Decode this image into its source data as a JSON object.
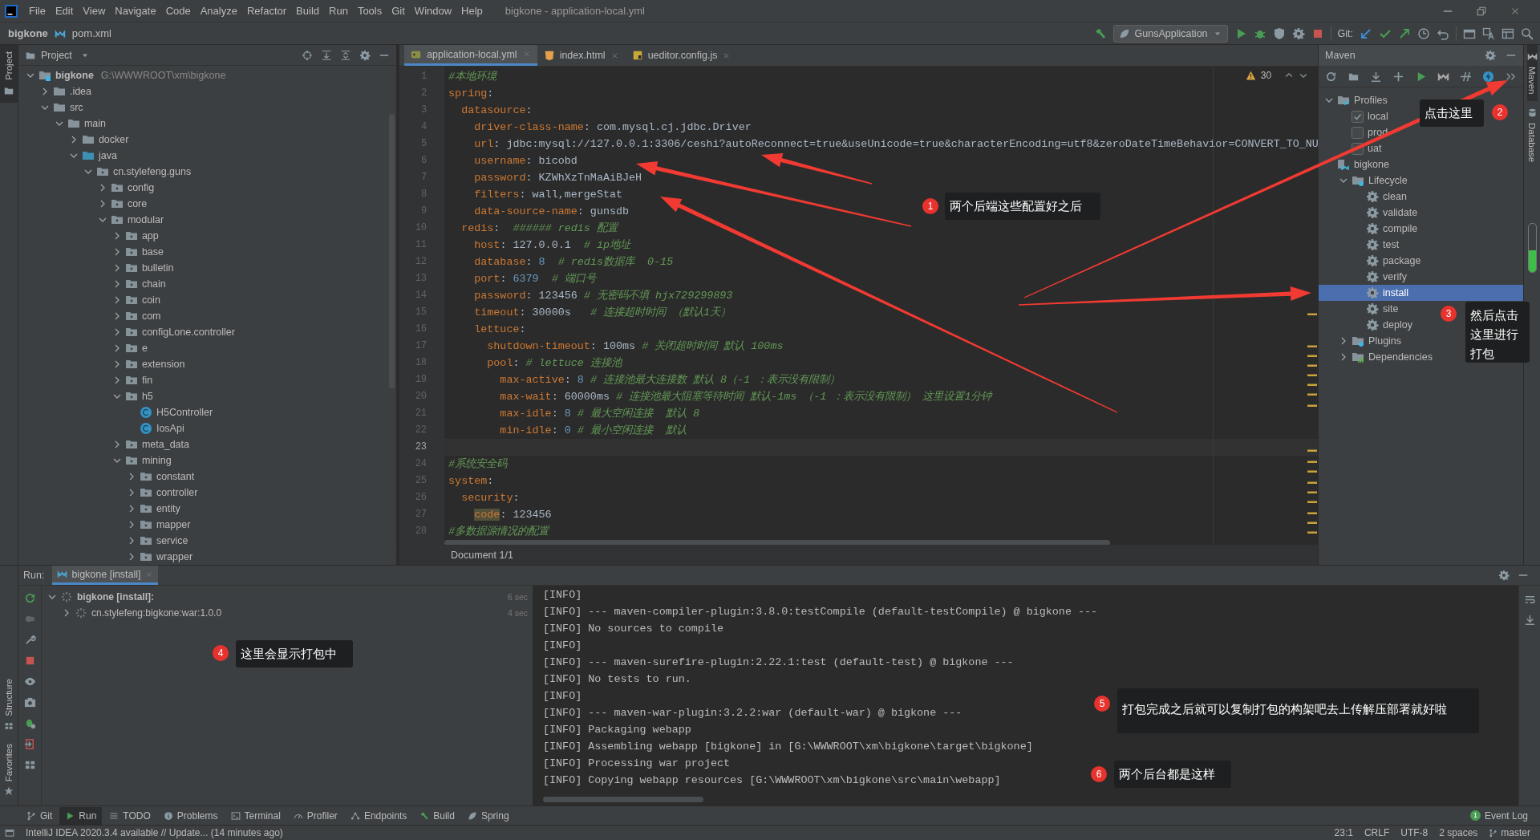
{
  "window": {
    "title": "bigkone - application-local.yml"
  },
  "menu": [
    "File",
    "Edit",
    "View",
    "Navigate",
    "Code",
    "Analyze",
    "Refactor",
    "Build",
    "Run",
    "Tools",
    "Git",
    "Window",
    "Help"
  ],
  "breadcrumb": [
    "bigkone",
    "pom.xml"
  ],
  "toolbar": {
    "run_config": "GunsApplication",
    "vcs_label": "Git:"
  },
  "left_strip": {
    "top": [
      "Project"
    ],
    "bottom": [
      "Structure",
      "Favorites"
    ]
  },
  "right_strip": [
    {
      "label": "Maven",
      "selected": true
    },
    {
      "label": "Database",
      "selected": false
    }
  ],
  "project": {
    "title": "Project",
    "tree": [
      {
        "name": "bigkone",
        "kind": "module",
        "path": "G:\\WWWROOT\\xm\\bigkone",
        "expanded": true,
        "children": [
          {
            "name": ".idea",
            "kind": "folder",
            "expanded": false
          },
          {
            "name": "src",
            "kind": "folder",
            "expanded": true,
            "children": [
              {
                "name": "main",
                "kind": "folder",
                "expanded": true,
                "children": [
                  {
                    "name": "docker",
                    "kind": "folder",
                    "expanded": false
                  },
                  {
                    "name": "java",
                    "kind": "source",
                    "expanded": true,
                    "children": [
                      {
                        "name": "cn.stylefeng.guns",
                        "kind": "package",
                        "expanded": true,
                        "children": [
                          {
                            "name": "config",
                            "kind": "package",
                            "expanded": false
                          },
                          {
                            "name": "core",
                            "kind": "package",
                            "expanded": false
                          },
                          {
                            "name": "modular",
                            "kind": "package",
                            "expanded": true,
                            "children": [
                              {
                                "name": "app",
                                "kind": "package",
                                "expanded": false
                              },
                              {
                                "name": "base",
                                "kind": "package",
                                "expanded": false
                              },
                              {
                                "name": "bulletin",
                                "kind": "package",
                                "expanded": false
                              },
                              {
                                "name": "chain",
                                "kind": "package",
                                "expanded": false
                              },
                              {
                                "name": "coin",
                                "kind": "package",
                                "expanded": false
                              },
                              {
                                "name": "com",
                                "kind": "package",
                                "expanded": false
                              },
                              {
                                "name": "configLone.controller",
                                "kind": "package",
                                "expanded": false
                              },
                              {
                                "name": "e",
                                "kind": "package",
                                "expanded": false
                              },
                              {
                                "name": "extension",
                                "kind": "package",
                                "expanded": false
                              },
                              {
                                "name": "fin",
                                "kind": "package",
                                "expanded": false
                              },
                              {
                                "name": "h5",
                                "kind": "package",
                                "expanded": true,
                                "children": [
                                  {
                                    "name": "H5Controller",
                                    "kind": "class"
                                  },
                                  {
                                    "name": "IosApi",
                                    "kind": "class"
                                  }
                                ]
                              },
                              {
                                "name": "meta_data",
                                "kind": "package",
                                "expanded": false
                              },
                              {
                                "name": "mining",
                                "kind": "package",
                                "expanded": true,
                                "children": [
                                  {
                                    "name": "constant",
                                    "kind": "package",
                                    "expanded": false
                                  },
                                  {
                                    "name": "controller",
                                    "kind": "package",
                                    "expanded": false
                                  },
                                  {
                                    "name": "entity",
                                    "kind": "package",
                                    "expanded": false
                                  },
                                  {
                                    "name": "mapper",
                                    "kind": "package",
                                    "expanded": false
                                  },
                                  {
                                    "name": "service",
                                    "kind": "package",
                                    "expanded": false
                                  },
                                  {
                                    "name": "wrapper",
                                    "kind": "package",
                                    "expanded": false
                                  }
                                ]
                              }
                            ]
                          }
                        ]
                      }
                    ]
                  }
                ]
              }
            ]
          }
        ]
      }
    ]
  },
  "editor": {
    "tabs": [
      {
        "label": "application-local.yml",
        "kind": "yaml",
        "selected": true
      },
      {
        "label": "index.html",
        "kind": "html",
        "selected": false
      },
      {
        "label": "ueditor.config.js",
        "kind": "js",
        "selected": false
      }
    ],
    "warnings": "30",
    "lines": [
      {
        "number": "1",
        "current": false,
        "tokens": [
          {
            "kind": "comment",
            "text": "#本地环境"
          }
        ]
      },
      {
        "number": "2",
        "current": false,
        "tokens": [
          {
            "kind": "key",
            "text": "spring"
          },
          {
            "kind": "text",
            "text": ":"
          }
        ],
        "children": [
          {
            "number": "3",
            "current": false,
            "tokens": [
              {
                "kind": "key",
                "text": "datasource"
              },
              {
                "kind": "text",
                "text": ":"
              }
            ],
            "children": [
              {
                "number": "4",
                "current": false,
                "tokens": [
                  {
                    "kind": "key",
                    "text": "driver-class-name"
                  },
                  {
                    "kind": "text",
                    "text": ": com.mysql.cj.jdbc.Driver"
                  }
                ]
              },
              {
                "number": "5",
                "current": false,
                "tokens": [
                  {
                    "kind": "key",
                    "text": "url"
                  },
                  {
                    "kind": "text",
                    "text": ": jdbc:mysql://127.0.0.1:3306/ceshi?autoReconnect=true&useUnicode=true&characterEncoding=utf8&zeroDateTimeBehavior=CONVERT_TO_NU"
                  }
                ]
              },
              {
                "number": "6",
                "current": false,
                "tokens": [
                  {
                    "kind": "key",
                    "text": "username"
                  },
                  {
                    "kind": "text",
                    "text": ": bicobd"
                  }
                ]
              },
              {
                "number": "7",
                "current": false,
                "tokens": [
                  {
                    "kind": "key",
                    "text": "password"
                  },
                  {
                    "kind": "text",
                    "text": ": KZWhXzTnMaAiBJeH"
                  }
                ]
              },
              {
                "number": "8",
                "current": false,
                "tokens": [
                  {
                    "kind": "key",
                    "text": "filters"
                  },
                  {
                    "kind": "text",
                    "text": ": wall,mergeStat"
                  }
                ]
              },
              {
                "number": "9",
                "current": false,
                "tokens": [
                  {
                    "kind": "key",
                    "text": "data-source-name"
                  },
                  {
                    "kind": "text",
                    "text": ": gunsdb"
                  }
                ]
              }
            ]
          },
          {
            "number": "10",
            "current": false,
            "tokens": [
              {
                "kind": "key",
                "text": "redis"
              },
              {
                "kind": "text",
                "text": ":  "
              },
              {
                "kind": "comment",
                "text": "###### redis 配置"
              }
            ],
            "children": [
              {
                "number": "11",
                "current": false,
                "tokens": [
                  {
                    "kind": "key",
                    "text": "host"
                  },
                  {
                    "kind": "text",
                    "text": ": 127.0.0.1  "
                  },
                  {
                    "kind": "comment",
                    "text": "# ip地址"
                  }
                ]
              },
              {
                "number": "12",
                "current": false,
                "tokens": [
                  {
                    "kind": "key",
                    "text": "database"
                  },
                  {
                    "kind": "text",
                    "text": ": "
                  },
                  {
                    "kind": "number",
                    "text": "8"
                  },
                  {
                    "kind": "comment",
                    "text": "  # redis数据库  0-15"
                  }
                ]
              },
              {
                "number": "13",
                "current": false,
                "tokens": [
                  {
                    "kind": "key",
                    "text": "port"
                  },
                  {
                    "kind": "text",
                    "text": ": "
                  },
                  {
                    "kind": "number",
                    "text": "6379"
                  },
                  {
                    "kind": "comment",
                    "text": "  # 端口号"
                  }
                ]
              },
              {
                "number": "14",
                "current": false,
                "tokens": [
                  {
                    "kind": "key",
                    "text": "password"
                  },
                  {
                    "kind": "text",
                    "text": ": 123456 "
                  },
                  {
                    "kind": "comment",
                    "text": "# 无密码不填 hjx729299893"
                  }
                ]
              },
              {
                "number": "15",
                "current": false,
                "tokens": [
                  {
                    "kind": "key",
                    "text": "timeout"
                  },
                  {
                    "kind": "text",
                    "text": ": 30000s   "
                  },
                  {
                    "kind": "comment",
                    "text": "# 连接超时时间 （默认1天）"
                  }
                ]
              },
              {
                "number": "16",
                "current": false,
                "tokens": [
                  {
                    "kind": "key",
                    "text": "lettuce"
                  },
                  {
                    "kind": "text",
                    "text": ":"
                  }
                ],
                "children": [
                  {
                    "number": "17",
                    "current": false,
                    "tokens": [
                      {
                        "kind": "key",
                        "text": "shutdown-timeout"
                      },
                      {
                        "kind": "text",
                        "text": ": 100ms "
                      },
                      {
                        "kind": "comment",
                        "text": "# 关闭超时时间 默认 100ms"
                      }
                    ]
                  },
                  {
                    "number": "18",
                    "current": false,
                    "tokens": [
                      {
                        "kind": "key",
                        "text": "pool"
                      },
                      {
                        "kind": "text",
                        "text": ": "
                      },
                      {
                        "kind": "comment",
                        "text": "# lettuce 连接池"
                      }
                    ],
                    "children": [
                      {
                        "number": "19",
                        "current": false,
                        "tokens": [
                          {
                            "kind": "key",
                            "text": "max-active"
                          },
                          {
                            "kind": "text",
                            "text": ": "
                          },
                          {
                            "kind": "number",
                            "text": "8"
                          },
                          {
                            "kind": "comment",
                            "text": " # 连接池最大连接数 默认 8（-1 ：表示没有限制）"
                          }
                        ]
                      },
                      {
                        "number": "20",
                        "current": false,
                        "tokens": [
                          {
                            "kind": "key",
                            "text": "max-wait"
                          },
                          {
                            "kind": "text",
                            "text": ": 60000ms "
                          },
                          {
                            "kind": "comment",
                            "text": "# 连接池最大阻塞等待时间 默认-1ms （-1 ：表示没有限制） 这里设置1分钟"
                          }
                        ]
                      },
                      {
                        "number": "21",
                        "current": false,
                        "tokens": [
                          {
                            "kind": "key",
                            "text": "max-idle"
                          },
                          {
                            "kind": "text",
                            "text": ": "
                          },
                          {
                            "kind": "number",
                            "text": "8"
                          },
                          {
                            "kind": "comment",
                            "text": " # 最大空闲连接  默认 8"
                          }
                        ]
                      },
                      {
                        "number": "22",
                        "current": false,
                        "tokens": [
                          {
                            "kind": "key",
                            "text": "min-idle"
                          },
                          {
                            "kind": "text",
                            "text": ": "
                          },
                          {
                            "kind": "number",
                            "text": "0"
                          },
                          {
                            "kind": "comment",
                            "text": " # 最小空闲连接  默认"
                          }
                        ]
                      }
                    ]
                  }
                ]
              }
            ]
          }
        ]
      },
      {
        "number": "23",
        "current": true
      },
      {
        "number": "24",
        "current": false,
        "tokens": [
          {
            "kind": "comment",
            "text": "#系统安全码"
          }
        ]
      },
      {
        "number": "25",
        "current": false,
        "tokens": [
          {
            "kind": "key",
            "text": "system"
          },
          {
            "kind": "text",
            "text": ":"
          }
        ],
        "children": [
          {
            "number": "26",
            "current": false,
            "tokens": [
              {
                "kind": "key",
                "text": "security"
              },
              {
                "kind": "text",
                "text": ":"
              }
            ],
            "children": [
              {
                "number": "27",
                "current": false,
                "tokens": [
                  {
                    "kind": "key-marked",
                    "text": "code"
                  },
                  {
                    "kind": "text",
                    "text": ": 123456"
                  }
                ]
              }
            ]
          }
        ]
      },
      {
        "number": "28",
        "current": false,
        "tokens": [
          {
            "kind": "comment",
            "text": "#多数据源情况的配置"
          }
        ]
      }
    ],
    "status": "Document 1/1"
  },
  "maven": {
    "title": "Maven",
    "tree": [
      {
        "name": "Profiles",
        "kind": "profiles",
        "expanded": true,
        "children": [
          {
            "name": "local",
            "kind": "profile",
            "checked": true
          },
          {
            "name": "prod",
            "kind": "profile",
            "checked": false
          },
          {
            "name": "uat",
            "kind": "profile",
            "checked": false
          }
        ]
      },
      {
        "name": "bigkone",
        "kind": "module",
        "children": [
          {
            "name": "Lifecycle",
            "kind": "lifecycle",
            "expanded": true,
            "children": [
              {
                "name": "clean",
                "kind": "goal",
                "selected": false
              },
              {
                "name": "validate",
                "kind": "goal",
                "selected": false
              },
              {
                "name": "compile",
                "kind": "goal",
                "selected": false
              },
              {
                "name": "test",
                "kind": "goal",
                "selected": false
              },
              {
                "name": "package",
                "kind": "goal",
                "selected": false
              },
              {
                "name": "verify",
                "kind": "goal",
                "selected": false
              },
              {
                "name": "install",
                "kind": "goal",
                "selected": true
              },
              {
                "name": "site",
                "kind": "goal",
                "selected": false
              },
              {
                "name": "deploy",
                "kind": "goal",
                "selected": false
              }
            ]
          },
          {
            "name": "Plugins",
            "kind": "plugins",
            "expanded": false
          },
          {
            "name": "Dependencies",
            "kind": "dependencies",
            "expanded": false
          }
        ]
      }
    ]
  },
  "run": {
    "label": "Run:",
    "tab": "bigkone [install]",
    "tree": [
      {
        "name": "bigkone [install]:",
        "time": "6 sec",
        "expanded": true,
        "children": [
          {
            "name": "cn.stylefeng:bigkone:war:1.0.0",
            "time": "4 sec",
            "expanded": false
          }
        ]
      }
    ],
    "console": [
      "[INFO]",
      "[INFO] --- maven-compiler-plugin:3.8.0:testCompile (default-testCompile) @ bigkone ---",
      "[INFO] No sources to compile",
      "[INFO]",
      "[INFO] --- maven-surefire-plugin:2.22.1:test (default-test) @ bigkone ---",
      "[INFO] No tests to run.",
      "[INFO]",
      "[INFO] --- maven-war-plugin:3.2.2:war (default-war) @ bigkone ---",
      "[INFO] Packaging webapp",
      "[INFO] Assembling webapp [bigkone] in [G:\\WWWROOT\\xm\\bigkone\\target\\bigkone]",
      "[INFO] Processing war project",
      "[INFO] Copying webapp resources [G:\\WWWROOT\\xm\\bigkone\\src\\main\\webapp]"
    ]
  },
  "bottom_tabs": [
    {
      "label": "Git",
      "kind": "git",
      "selected": false
    },
    {
      "label": "Run",
      "kind": "run",
      "selected": true
    },
    {
      "label": "TODO",
      "kind": "todo",
      "selected": false
    },
    {
      "label": "Problems",
      "kind": "problems",
      "selected": false
    },
    {
      "label": "Terminal",
      "kind": "terminal",
      "selected": false
    },
    {
      "label": "Profiler",
      "kind": "profiler",
      "selected": false
    },
    {
      "label": "Endpoints",
      "kind": "endpoints",
      "selected": false
    },
    {
      "label": "Build",
      "kind": "build",
      "selected": false
    },
    {
      "label": "Spring",
      "kind": "spring",
      "selected": false
    }
  ],
  "event_log": {
    "label": "Event Log",
    "count": "1"
  },
  "status_bar": {
    "message": "IntelliJ IDEA 2020.3.4 available // Update... (14 minutes ago)",
    "items": [
      "23:1",
      "CRLF",
      "UTF-8",
      "2 spaces"
    ],
    "branch": "master"
  },
  "annotations": [
    {
      "number": "1",
      "text": "两个后端这些配置好之后"
    },
    {
      "number": "2",
      "text": "点击这里"
    },
    {
      "number": "3",
      "text": "然后点击这里进行打包"
    },
    {
      "number": "4",
      "text": "这里会显示打包中"
    },
    {
      "number": "5",
      "text": "打包完成之后就可以复制打包的构架吧去上传解压部署就好啦"
    },
    {
      "number": "6",
      "text": "两个后台都是这样"
    }
  ]
}
